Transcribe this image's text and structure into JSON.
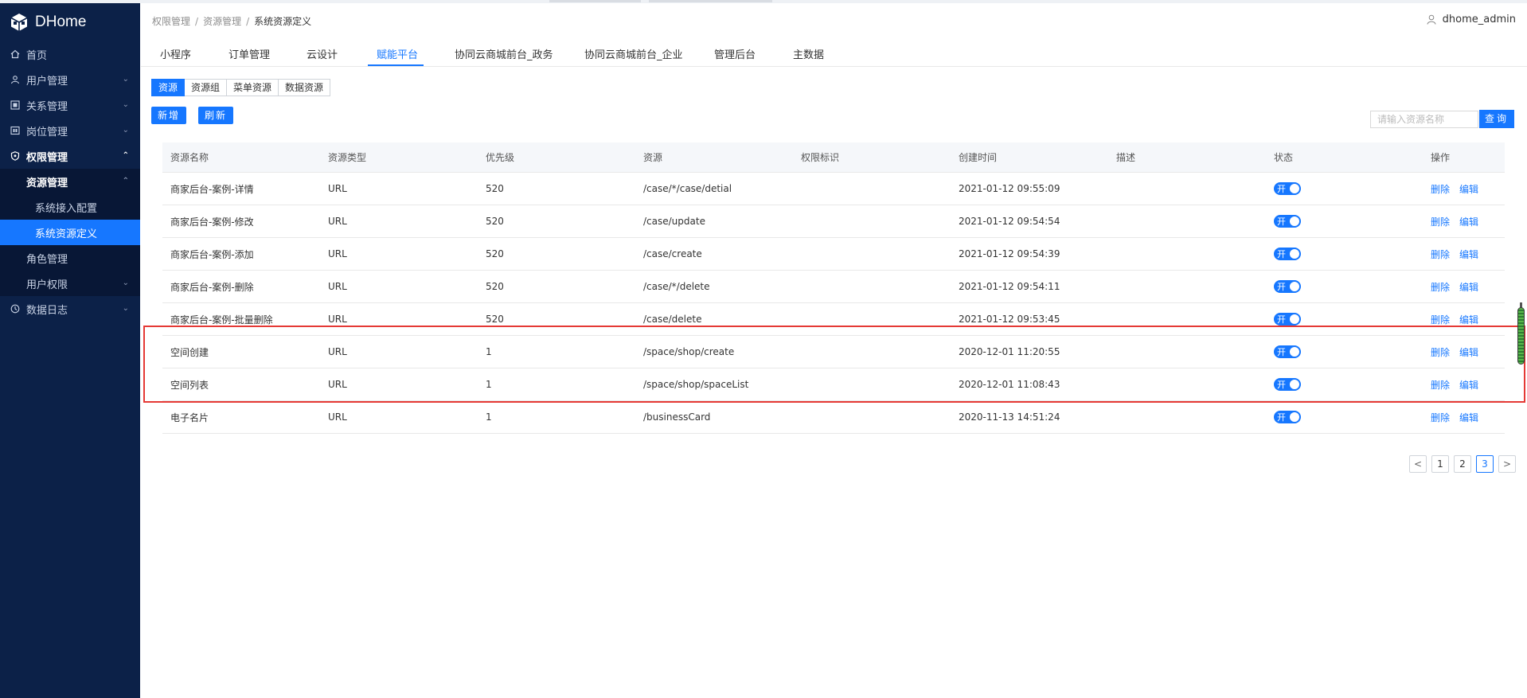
{
  "app": {
    "name": "DHome"
  },
  "sidebar": {
    "items": [
      {
        "label": "首页",
        "icon": "home-icon"
      },
      {
        "label": "用户管理",
        "icon": "user-icon"
      },
      {
        "label": "关系管理",
        "icon": "relation-icon"
      },
      {
        "label": "岗位管理",
        "icon": "position-icon"
      },
      {
        "label": "权限管理",
        "icon": "shield-icon"
      },
      {
        "label": "资源管理"
      },
      {
        "label": "系统接入配置"
      },
      {
        "label": "系统资源定义"
      },
      {
        "label": "角色管理"
      },
      {
        "label": "用户权限"
      },
      {
        "label": "数据日志",
        "icon": "log-icon"
      }
    ]
  },
  "breadcrumb": [
    "权限管理",
    "资源管理",
    "系统资源定义"
  ],
  "user": {
    "name": "dhome_admin"
  },
  "tabs": [
    "小程序",
    "订单管理",
    "云设计",
    "赋能平台",
    "协同云商城前台_政务",
    "协同云商城前台_企业",
    "管理后台",
    "主数据"
  ],
  "active_tab": "赋能平台",
  "segments": [
    "资源",
    "资源组",
    "菜单资源",
    "数据资源"
  ],
  "buttons": {
    "add": "新增",
    "refresh": "刷新",
    "search": "查询"
  },
  "search": {
    "placeholder": "请输入资源名称",
    "value": ""
  },
  "table": {
    "headers": [
      "资源名称",
      "资源类型",
      "优先级",
      "资源",
      "权限标识",
      "创建时间",
      "描述",
      "状态",
      "操作"
    ],
    "rows": [
      {
        "name": "商家后台-案例-详情",
        "type": "URL",
        "priority": "520",
        "resource": "/case/*/case/detial",
        "perm": "",
        "created": "2021-01-12 09:55:09",
        "desc": "",
        "status": "开"
      },
      {
        "name": "商家后台-案例-修改",
        "type": "URL",
        "priority": "520",
        "resource": "/case/update",
        "perm": "",
        "created": "2021-01-12 09:54:54",
        "desc": "",
        "status": "开"
      },
      {
        "name": "商家后台-案例-添加",
        "type": "URL",
        "priority": "520",
        "resource": "/case/create",
        "perm": "",
        "created": "2021-01-12 09:54:39",
        "desc": "",
        "status": "开"
      },
      {
        "name": "商家后台-案例-删除",
        "type": "URL",
        "priority": "520",
        "resource": "/case/*/delete",
        "perm": "",
        "created": "2021-01-12 09:54:11",
        "desc": "",
        "status": "开"
      },
      {
        "name": "商家后台-案例-批量删除",
        "type": "URL",
        "priority": "520",
        "resource": "/case/delete",
        "perm": "",
        "created": "2021-01-12 09:53:45",
        "desc": "",
        "status": "开"
      },
      {
        "name": "空间创建",
        "type": "URL",
        "priority": "1",
        "resource": "/space/shop/create",
        "perm": "",
        "created": "2020-12-01 11:20:55",
        "desc": "",
        "status": "开"
      },
      {
        "name": "空间列表",
        "type": "URL",
        "priority": "1",
        "resource": "/space/shop/spaceList",
        "perm": "",
        "created": "2020-12-01 11:08:43",
        "desc": "",
        "status": "开"
      },
      {
        "name": "电子名片",
        "type": "URL",
        "priority": "1",
        "resource": "/businessCard",
        "perm": "",
        "created": "2020-11-13 14:51:24",
        "desc": "",
        "status": "开"
      }
    ],
    "actions": {
      "delete": "删除",
      "edit": "编辑"
    }
  },
  "pagination": {
    "pages": [
      "1",
      "2",
      "3"
    ],
    "current": "3"
  },
  "colors": {
    "sidebar_bg": "#0c2148",
    "accent": "#1677ff",
    "highlight": "#e53935"
  }
}
